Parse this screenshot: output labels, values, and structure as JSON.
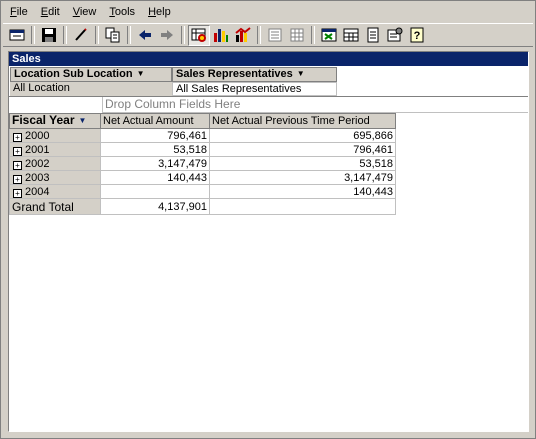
{
  "menu": {
    "file": "File",
    "edit": "Edit",
    "view": "View",
    "tools": "Tools",
    "help": "Help"
  },
  "toolbar": {
    "icons": [
      "properties-icon",
      "save-icon",
      "edit-pen-icon",
      "copy-icon",
      "back-arrow-icon",
      "forward-arrow-icon",
      "pivot-table-icon",
      "bar-chart-icon",
      "chart-types-icon",
      "list-icon",
      "grid-icon",
      "excel-export-icon",
      "calculator-icon",
      "notes-icon",
      "settings-icon",
      "help-icon"
    ]
  },
  "report": {
    "title": "Sales",
    "filters": [
      {
        "field": "Location Sub Location",
        "value": "All Location"
      },
      {
        "field": "Sales Representatives",
        "value": "All Sales Representatives"
      }
    ],
    "drop_zone": "Drop Column Fields Here",
    "row_field": "Fiscal Year",
    "columns": [
      "Net Actual Amount",
      "Net Actual Previous Time Period"
    ],
    "rows": [
      {
        "year": "2000",
        "net_actual_amount": "796,461",
        "net_actual_previous": "695,866"
      },
      {
        "year": "2001",
        "net_actual_amount": "53,518",
        "net_actual_previous": "796,461"
      },
      {
        "year": "2002",
        "net_actual_amount": "3,147,479",
        "net_actual_previous": "53,518"
      },
      {
        "year": "2003",
        "net_actual_amount": "140,443",
        "net_actual_previous": "3,147,479"
      },
      {
        "year": "2004",
        "net_actual_amount": "",
        "net_actual_previous": "140,443"
      }
    ],
    "grand_total": {
      "label": "Grand Total",
      "net_actual_amount": "4,137,901",
      "net_actual_previous": ""
    }
  }
}
